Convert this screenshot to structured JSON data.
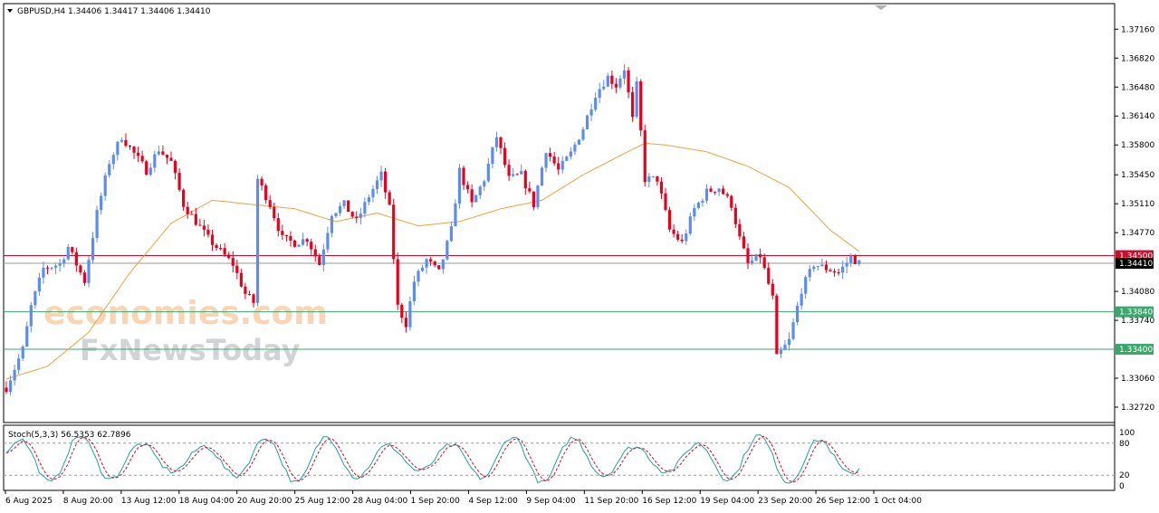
{
  "header": {
    "symbol": "GBPUSD,H4",
    "ohlc": "1.34406 1.34417 1.34406 1.34410",
    "stoch_label": "Stoch(5,3,3) 56.5353 62.7896"
  },
  "watermark": {
    "line1": "economies.com",
    "line2": "FxNewsToday"
  },
  "colors": {
    "bull": "#5b8def",
    "bear": "#e8001c",
    "ma": "#f0a040",
    "stoch_main": "#1aa3a3",
    "stoch_signal": "#e8001c",
    "level_red": "#c8102e",
    "level_green": "#3aa76d",
    "price_tag": "#000000"
  },
  "chart_data": {
    "type": "candlestick",
    "price_axis": {
      "ylim": [
        1.3255,
        1.3745
      ],
      "ticks": [
        "1.37160",
        "1.36820",
        "1.36480",
        "1.36140",
        "1.35800",
        "1.35450",
        "1.35110",
        "1.34770",
        "1.34080",
        "1.33740",
        "1.33060",
        "1.32720"
      ]
    },
    "time_axis": {
      "labels": [
        "6 Aug 2025",
        "8 Aug 20:00",
        "13 Aug 12:00",
        "18 Aug 04:00",
        "20 Aug 20:00",
        "25 Aug 12:00",
        "28 Aug 04:00",
        "1 Sep 20:00",
        "4 Sep 12:00",
        "9 Sep 04:00",
        "11 Sep 20:00",
        "16 Sep 12:00",
        "19 Sep 04:00",
        "23 Sep 20:00",
        "26 Sep 12:00",
        "1 Oct 04:00"
      ]
    },
    "levels": [
      {
        "label": "1.34500",
        "value": 1.345,
        "kind": "resistance"
      },
      {
        "label": "1.34410",
        "value": 1.3441,
        "kind": "current"
      },
      {
        "label": "1.33840",
        "value": 1.3384,
        "kind": "support"
      },
      {
        "label": "1.33400",
        "value": 1.334,
        "kind": "support"
      }
    ],
    "anchors": [
      [
        0,
        1.3295
      ],
      [
        4,
        1.334
      ],
      [
        6,
        1.339
      ],
      [
        9,
        1.3435
      ],
      [
        13,
        1.344
      ],
      [
        15,
        1.346
      ],
      [
        19,
        1.342
      ],
      [
        22,
        1.35
      ],
      [
        25,
        1.356
      ],
      [
        28,
        1.359
      ],
      [
        31,
        1.357
      ],
      [
        34,
        1.355
      ],
      [
        37,
        1.3575
      ],
      [
        40,
        1.356
      ],
      [
        43,
        1.351
      ],
      [
        46,
        1.349
      ],
      [
        49,
        1.347
      ],
      [
        52,
        1.3455
      ],
      [
        55,
        1.344
      ],
      [
        58,
        1.3405
      ],
      [
        60,
        1.3395
      ],
      [
        61,
        1.354
      ],
      [
        64,
        1.351
      ],
      [
        67,
        1.347
      ],
      [
        70,
        1.3465
      ],
      [
        73,
        1.347
      ],
      [
        76,
        1.344
      ],
      [
        79,
        1.35
      ],
      [
        82,
        1.351
      ],
      [
        85,
        1.349
      ],
      [
        88,
        1.352
      ],
      [
        91,
        1.3545
      ],
      [
        93,
        1.3505
      ],
      [
        95,
        1.339
      ],
      [
        97,
        1.337
      ],
      [
        99,
        1.342
      ],
      [
        102,
        1.3445
      ],
      [
        105,
        1.343
      ],
      [
        108,
        1.348
      ],
      [
        110,
        1.355
      ],
      [
        113,
        1.351
      ],
      [
        116,
        1.354
      ],
      [
        119,
        1.359
      ],
      [
        122,
        1.354
      ],
      [
        125,
        1.3545
      ],
      [
        128,
        1.351
      ],
      [
        131,
        1.3575
      ],
      [
        134,
        1.355
      ],
      [
        137,
        1.357
      ],
      [
        140,
        1.36
      ],
      [
        143,
        1.364
      ],
      [
        146,
        1.366
      ],
      [
        148,
        1.365
      ],
      [
        150,
        1.367
      ],
      [
        152,
        1.361
      ],
      [
        153,
        1.365
      ],
      [
        155,
        1.354
      ],
      [
        158,
        1.354
      ],
      [
        161,
        1.348
      ],
      [
        164,
        1.3465
      ],
      [
        167,
        1.3505
      ],
      [
        170,
        1.3525
      ],
      [
        173,
        1.353
      ],
      [
        176,
        1.351
      ],
      [
        178,
        1.347
      ],
      [
        180,
        1.344
      ],
      [
        183,
        1.345
      ],
      [
        186,
        1.34
      ],
      [
        187,
        1.333
      ],
      [
        190,
        1.335
      ],
      [
        193,
        1.341
      ],
      [
        196,
        1.344
      ],
      [
        199,
        1.3435
      ],
      [
        202,
        1.343
      ],
      [
        205,
        1.3448
      ],
      [
        207,
        1.3441
      ]
    ],
    "ma_anchors": [
      [
        0,
        1.3305
      ],
      [
        10,
        1.332
      ],
      [
        20,
        1.336
      ],
      [
        30,
        1.343
      ],
      [
        40,
        1.3488
      ],
      [
        50,
        1.3515
      ],
      [
        60,
        1.351
      ],
      [
        70,
        1.3505
      ],
      [
        80,
        1.349
      ],
      [
        90,
        1.35
      ],
      [
        100,
        1.3485
      ],
      [
        110,
        1.349
      ],
      [
        120,
        1.3505
      ],
      [
        130,
        1.3515
      ],
      [
        140,
        1.3545
      ],
      [
        150,
        1.357
      ],
      [
        155,
        1.3582
      ],
      [
        160,
        1.358
      ],
      [
        170,
        1.3572
      ],
      [
        180,
        1.3555
      ],
      [
        190,
        1.353
      ],
      [
        200,
        1.348
      ],
      [
        207,
        1.3455
      ]
    ],
    "stoch_axis": {
      "ylim": [
        0,
        100
      ],
      "ticks": [
        "100",
        "80",
        "20",
        "0"
      ],
      "levels": [
        80,
        20
      ]
    }
  }
}
